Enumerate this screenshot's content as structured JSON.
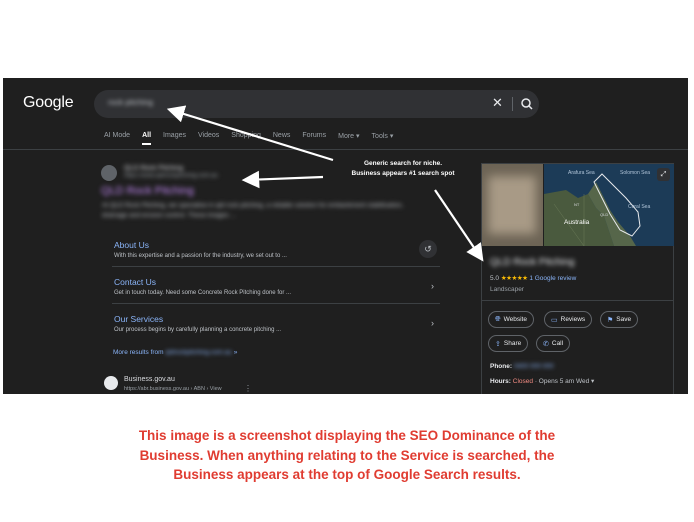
{
  "google": {
    "logo": "Google",
    "search_query": "rock pitching",
    "clear_icon": "✕",
    "search_icon": "search-icon"
  },
  "tabs": [
    "AI Mode",
    "All",
    "Images",
    "Videos",
    "Shopping",
    "News",
    "Forums",
    "More ▾",
    "Tools ▾"
  ],
  "active_tab": "All",
  "result": {
    "site_name": "QLD Rock Pitching",
    "site_url": "https://www.qldrockpitching.com.au",
    "title": "QLD Rock Pitching",
    "snippet": "At QLD Rock Pitching, we specialise in qld rock pitching, a reliable solution for embankment stabilisation, drainage and erosion control. These images ...",
    "sitelinks": [
      {
        "title": "About Us",
        "desc": "With this expertise and a passion for the industry, we set out to ...",
        "icon": "history-icon"
      },
      {
        "title": "Contact Us",
        "desc": "Get in touch today. Need some Concrete Rock Pitching done for ...",
        "icon": "chevron-right-icon"
      },
      {
        "title": "Our Services",
        "desc": "Our process begins by carefully planning a concrete pitching ...",
        "icon": "chevron-right-icon"
      }
    ],
    "more_results_prefix": "More results from",
    "more_results_domain": "qldrockpitching.com.au",
    "more_results_suffix": "»"
  },
  "second_result": {
    "name": "Business.gov.au",
    "url": "https://abr.business.gov.au › ABN › View",
    "menu": "⋮"
  },
  "knowledge_panel": {
    "map_labels": [
      "Arafura Sea",
      "Solomon Sea",
      "Coral Sea",
      "Australia",
      "QLD",
      "NT"
    ],
    "title": "QLD Rock Pitching",
    "rating": "5.0",
    "stars": "★★★★★",
    "review_count": "1 Google review",
    "category": "Landscaper",
    "actions": [
      {
        "label": "Website",
        "icon": "globe-icon"
      },
      {
        "label": "Reviews",
        "icon": "reviews-icon"
      },
      {
        "label": "Save",
        "icon": "bookmark-icon"
      },
      {
        "label": "Share",
        "icon": "share-icon"
      },
      {
        "label": "Call",
        "icon": "phone-icon"
      }
    ],
    "phone_label": "Phone:",
    "phone_value": "0400 000 000",
    "hours_label": "Hours:",
    "hours_status": "Closed",
    "hours_next": "· Opens 5 am Wed ▾"
  },
  "annotation": {
    "line1": "Generic search for niche.",
    "line2": "Business appears #1 search spot"
  },
  "caption": {
    "line1": "This image is a screenshot displaying the SEO Dominance of the",
    "line2": "Business. When anything relating to the Service is searched, the",
    "line3": "Business appears at the top of Google Search results."
  },
  "colors": {
    "background": "#1f1f1f",
    "link": "#8ab4f8",
    "visited_title": "#c58af9",
    "star": "#fbbc04",
    "closed": "#f28b82",
    "caption": "#e03c31"
  }
}
